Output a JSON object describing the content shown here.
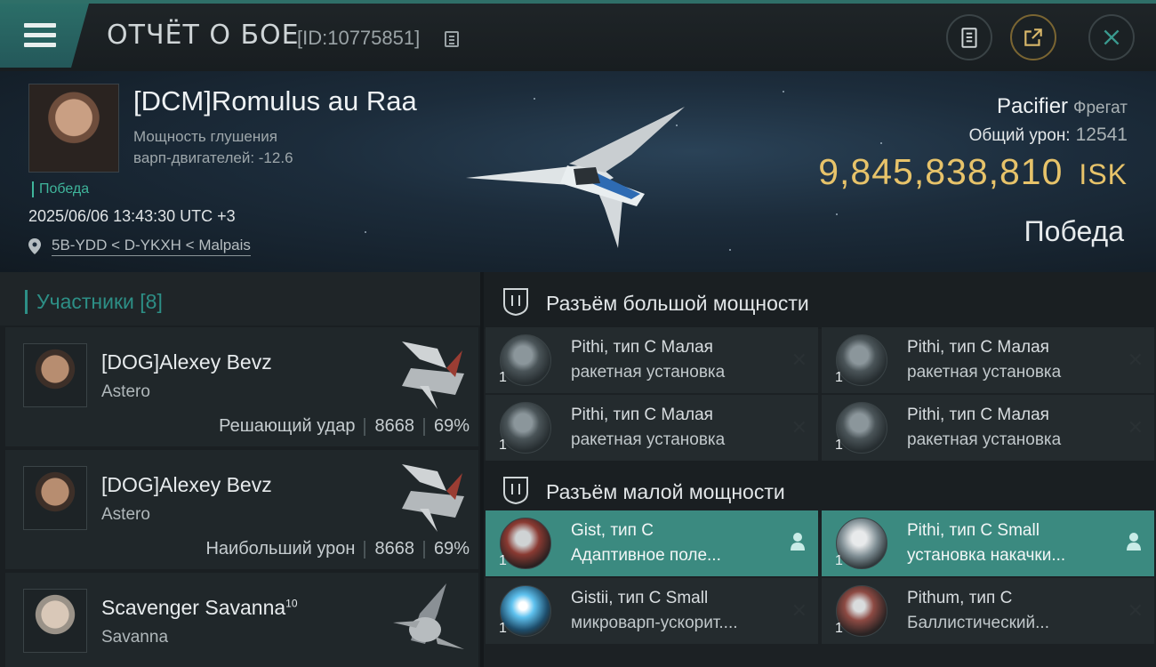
{
  "header": {
    "title": "ОТЧЁТ О БОЕ",
    "battle_id": "[ID:10775851]"
  },
  "hero": {
    "pilot_name": "[DCM]Romulus au Raa",
    "stat_line1": "Мощность глушения",
    "stat_line2": "варп-двигателей: -12.6",
    "result_tag": "Победа",
    "datetime": "2025/06/06 13:43:30 UTC +3",
    "location": "5B-YDD < D-YKXH < Malpais",
    "ship_name": "Pacifier",
    "ship_class": "Фрегат",
    "total_damage_label": "Общий урон:",
    "total_damage_value": "12541",
    "isk_value": "9,845,838,810",
    "isk_currency": "ISK",
    "verdict": "Победа"
  },
  "participants": {
    "label": "Участники [8]",
    "rows": [
      {
        "name": "[DOG]Alexey Bevz",
        "ship": "Astero",
        "role": "Решающий удар",
        "damage": "8668",
        "percent": "69%"
      },
      {
        "name": "[DOG]Alexey Bevz",
        "ship": "Astero",
        "role": "Наибольший урон",
        "damage": "8668",
        "percent": "69%"
      },
      {
        "name": "Scavenger Savanna",
        "name_sup": "10",
        "ship": "Savanna"
      }
    ]
  },
  "fittings": {
    "high_slots_label": "Разъём большой мощности",
    "low_slots_label": "Разъём малой мощности",
    "high": [
      {
        "line1": "Pithi, тип C Малая",
        "line2": "ракетная установка",
        "qty": "1"
      },
      {
        "line1": "Pithi, тип C Малая",
        "line2": "ракетная установка",
        "qty": "1"
      },
      {
        "line1": "Pithi, тип C Малая",
        "line2": "ракетная установка",
        "qty": "1"
      },
      {
        "line1": "Pithi, тип C Малая",
        "line2": "ракетная установка",
        "qty": "1"
      }
    ],
    "low": [
      {
        "line1": "Gist, тип C",
        "line2": "Адаптивное поле...",
        "qty": "1"
      },
      {
        "line1": "Pithi, тип C Small",
        "line2": "установка накачки...",
        "qty": "1"
      },
      {
        "line1": "Gistii, тип C Small",
        "line2": "микроварп-ускорит....",
        "qty": "1"
      },
      {
        "line1": "Pithum, тип C",
        "line2": "Баллистический...",
        "qty": "1"
      }
    ],
    "close_glyph": "✕"
  },
  "colors": {
    "accent_teal": "#2d8f86",
    "victory_green": "#3fb59b",
    "isk_gold": "#e7c36a",
    "active_slot": "#3b8a80"
  }
}
